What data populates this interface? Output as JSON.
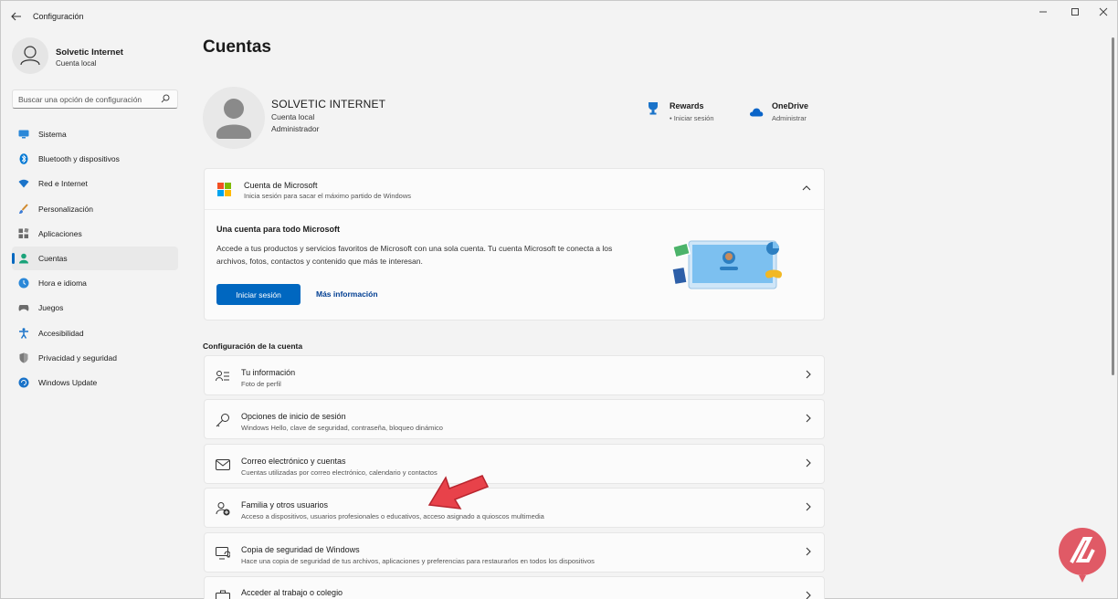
{
  "titlebar": {
    "app_title": "Configuración",
    "back_icon": "back-arrow-icon",
    "controls": [
      "minimize-icon",
      "maximize-icon",
      "close-icon"
    ]
  },
  "sidebar": {
    "profile": {
      "name": "Solvetic Internet",
      "type": "Cuenta local"
    },
    "search": {
      "placeholder": "Buscar una opción de configuración"
    },
    "items": [
      {
        "label": "Sistema",
        "icon": "system-icon"
      },
      {
        "label": "Bluetooth y dispositivos",
        "icon": "bluetooth-icon"
      },
      {
        "label": "Red e Internet",
        "icon": "wifi-icon"
      },
      {
        "label": "Personalización",
        "icon": "brush-icon"
      },
      {
        "label": "Aplicaciones",
        "icon": "apps-icon"
      },
      {
        "label": "Cuentas",
        "icon": "account-icon",
        "active": true
      },
      {
        "label": "Hora e idioma",
        "icon": "clock-globe-icon"
      },
      {
        "label": "Juegos",
        "icon": "gamepad-icon"
      },
      {
        "label": "Accesibilidad",
        "icon": "accessibility-icon"
      },
      {
        "label": "Privacidad y seguridad",
        "icon": "shield-icon"
      },
      {
        "label": "Windows Update",
        "icon": "update-icon"
      }
    ]
  },
  "main": {
    "page_title": "Cuentas",
    "user": {
      "name": "SOLVETIC INTERNET",
      "line1": "Cuenta local",
      "line2": "Administrador"
    },
    "services": [
      {
        "name": "Rewards",
        "sub": "Iniciar sesión",
        "icon": "rewards-trophy-icon"
      },
      {
        "name": "OneDrive",
        "sub": "Administrar",
        "icon": "onedrive-cloud-icon"
      }
    ],
    "ms_account": {
      "title": "Cuenta de Microsoft",
      "subtitle": "Inicia sesión para sacar el máximo partido de Windows",
      "body_title": "Una cuenta para todo Microsoft",
      "body_text": "Accede a tus productos y servicios favoritos de Microsoft con una sola cuenta. Tu cuenta Microsoft te conecta a los archivos, fotos, contactos y contenido que más te interesan.",
      "primary_button": "Iniciar sesión",
      "link": "Más información",
      "colors": [
        "#f25022",
        "#7fba00",
        "#00a4ef",
        "#ffb900"
      ]
    },
    "section_title": "Configuración de la cuenta",
    "rows": [
      {
        "title": "Tu información",
        "sub": "Foto de perfil",
        "icon": "person-card-icon"
      },
      {
        "title": "Opciones de inicio de sesión",
        "sub": "Windows Hello, clave de seguridad, contraseña, bloqueo dinámico",
        "icon": "key-icon"
      },
      {
        "title": "Correo electrónico y cuentas",
        "sub": "Cuentas utilizadas por correo electrónico, calendario y contactos",
        "icon": "mail-icon"
      },
      {
        "title": "Familia y otros usuarios",
        "sub": "Acceso a dispositivos, usuarios profesionales o educativos, acceso asignado a quioscos multimedia",
        "icon": "family-add-icon"
      },
      {
        "title": "Copia de seguridad de Windows",
        "sub": "Hace una copia de seguridad de tus archivos, aplicaciones y preferencias para restaurarlos en todos los dispositivos",
        "icon": "backup-icon"
      },
      {
        "title": "Acceder al trabajo o colegio",
        "sub": "",
        "icon": "briefcase-icon"
      }
    ]
  },
  "colors": {
    "accent": "#0067c0",
    "arrow": "#e8424a",
    "watermark": "#e05a66"
  }
}
